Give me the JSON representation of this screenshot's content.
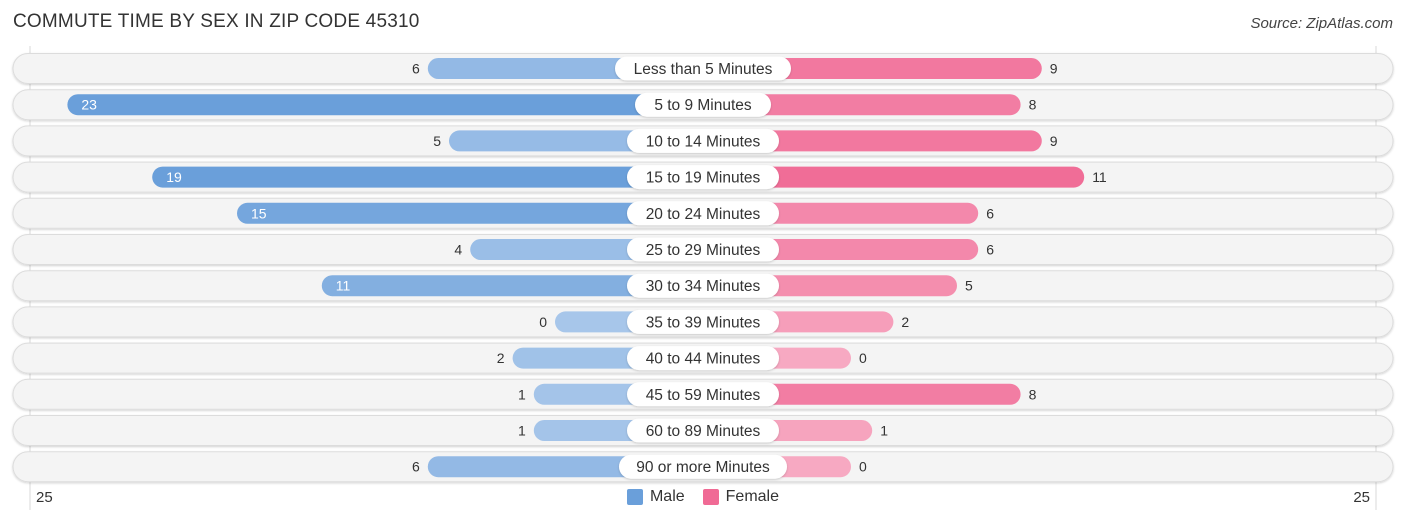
{
  "title": "COMMUTE TIME BY SEX IN ZIP CODE 45310",
  "source": "Source: ZipAtlas.com",
  "colors": {
    "male": "#6a9fda",
    "male_light": "#a7c6ea",
    "female": "#f06a95",
    "female_light": "#f7a9c2",
    "row_bg": "#f4f4f4"
  },
  "legend": {
    "male_label": "Male",
    "female_label": "Female"
  },
  "axis": {
    "left_label": "25",
    "right_label": "25"
  },
  "chart_data": {
    "type": "bar",
    "orientation": "horizontal-diverging",
    "title": "COMMUTE TIME BY SEX IN ZIP CODE 45310",
    "categories": [
      "Less than 5 Minutes",
      "5 to 9 Minutes",
      "10 to 14 Minutes",
      "15 to 19 Minutes",
      "20 to 24 Minutes",
      "25 to 29 Minutes",
      "30 to 34 Minutes",
      "35 to 39 Minutes",
      "40 to 44 Minutes",
      "45 to 59 Minutes",
      "60 to 89 Minutes",
      "90 or more Minutes"
    ],
    "series": [
      {
        "name": "Male",
        "values": [
          6,
          23,
          5,
          19,
          15,
          4,
          11,
          0,
          2,
          1,
          1,
          6
        ]
      },
      {
        "name": "Female",
        "values": [
          9,
          8,
          9,
          11,
          6,
          6,
          5,
          2,
          0,
          8,
          1,
          0
        ]
      }
    ],
    "xlim": [
      -25,
      25
    ],
    "xtick_labels": [
      "25",
      "25"
    ],
    "legend_position": "bottom-center",
    "grid": false
  }
}
